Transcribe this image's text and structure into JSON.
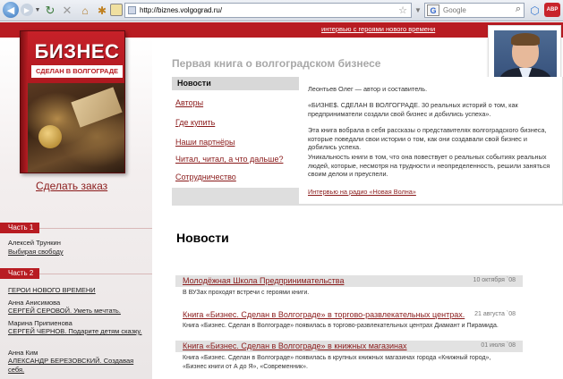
{
  "browser": {
    "url": "http://biznes.volgograd.ru/",
    "search_placeholder": "Google",
    "search_engine_letter": "G",
    "ext_badge": "ABP"
  },
  "header": {
    "top_link": "интервью с героями нового времени"
  },
  "book": {
    "title": "БИЗНЕС",
    "subtitle": "СДЕЛАН В ВОЛГОГРАДЕ"
  },
  "sidebar": {
    "order_link": "Сделать заказ",
    "part1": {
      "label": "Часть 1",
      "author": "Алексей Трункин",
      "link": "Выбирая свободу"
    },
    "part2": {
      "label": "Часть 2",
      "heroes_link": "ГЕРОИ НОВОГО ВРЕМЕНИ",
      "entries": [
        {
          "author": "Анна Анисимова",
          "link": "СЕРГЕЙ СЕРОВОЙ. Уметь мечтать."
        },
        {
          "author": "Марина Припиенова",
          "link": "СЕРГЕЙ ЧЕРНОВ. Подарите детям сказку."
        },
        {
          "author": "Анна Ким",
          "link": "АЛЕКСАНДР БЕРЕЗОВСКИЙ. Создавая себя."
        }
      ]
    }
  },
  "main": {
    "page_title": "Первая книга о волгоградском бизнесе",
    "nav": {
      "header": "Новости",
      "items": [
        "Авторы",
        "Где купить",
        "Наши партнёры",
        "Читал, читал, а что дальше?",
        "Сотрудничество"
      ]
    },
    "intro": {
      "p1": "Леонтьев Олег — автор и составитель.",
      "p2": "«БИЗНЕ$. СДЕЛАН В ВОЛГОГРАДЕ. 30 реальных историй о том, как предприниматели создали свой бизнес и добились успеха».",
      "p3": "Эта книга вобрала в себя рассказы о представителях волгоградского бизнеса, которые поведали свои истории о том, как они создавали свой бизнес и добились успеха.",
      "p4": "Уникальность книги в том, что она повествует о реальных событиях реальных людей, которые, несмотря на трудности и неопределенность, решили заняться своим делом и преуспели.",
      "radio_link": "Интервью на радио «Новая Волна»"
    },
    "news_heading": "Новости",
    "news": [
      {
        "title": "Молодёжная Школа Предпринимательства",
        "date": "10 октября `08",
        "text": "В ВУЗах проходят встречи с героями книги."
      },
      {
        "title": "Книга «Бизнес. Сделан в Волгограде» в торгово-развлекательных центрах.",
        "date": "21 августа `08",
        "text": "Книга «Бизнес. Сделан в Волгограде» появилась в торгово-развлекательных центрах Диамант и Пирамида."
      },
      {
        "title": "Книга «Бизнес. Сделан в Волгограде» в книжных магазинах",
        "date": "01 июля `08",
        "text": "Книга «Бизнес. Сделан в Волгограде» появилась в крупных книжных магазинах города «Книжный город», «Бизнес книги от А до Я», «Современник»."
      }
    ]
  },
  "colors": {
    "accent": "#b81c22",
    "link": "#8a1a1a",
    "nav_grey": "#d8d8d8",
    "title_grey": "#a8a8a8"
  }
}
